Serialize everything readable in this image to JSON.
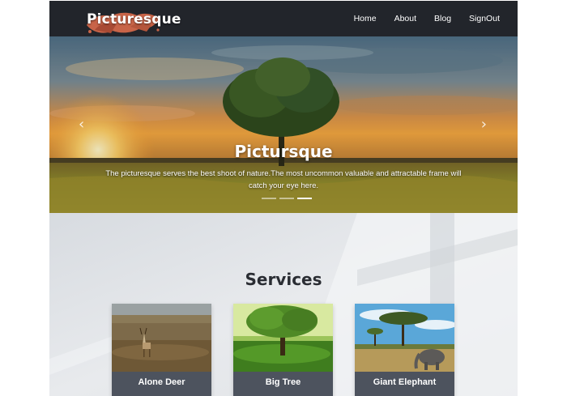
{
  "navbar": {
    "brand": "Picturesque",
    "links": [
      "Home",
      "About",
      "Blog",
      "SignOut"
    ]
  },
  "hero": {
    "title": "Pictursque",
    "text": "The picturesque serves the best shoot of nature.The most uncommon valuable and attractable frame will catch your eye here.",
    "prev_icon": "chevron-left-icon",
    "next_icon": "chevron-right-icon",
    "slides": 3,
    "active_slide": 3
  },
  "services": {
    "title": "Services",
    "cards": [
      {
        "label": "Alone Deer"
      },
      {
        "label": "Big Tree"
      },
      {
        "label": "Giant Elephant"
      }
    ]
  },
  "colors": {
    "navbar_bg": "#22252b",
    "card_label_bg": "#4d535e",
    "services_title": "#2a2d33"
  }
}
